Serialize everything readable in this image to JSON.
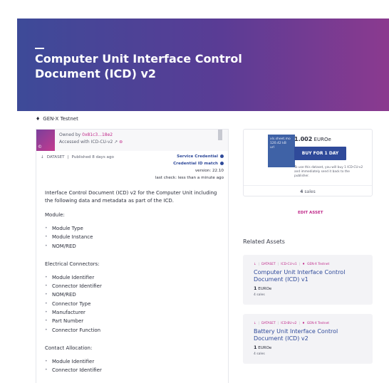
{
  "asset": {
    "title": "Computer Unit Interface Control Document (ICD) v2",
    "network": "GEN-X Testnet",
    "owned_by_label": "Owned by",
    "owner": "0x81c3...18e2",
    "accessed_with_label": "Accessed with",
    "accessed_with": "ICD-CU-v2",
    "type": "DATASET",
    "published": "Published 8 days ago",
    "service_credential": "Service Credential",
    "credential_id_match": "Credential ID match",
    "version": "version: 22.10",
    "last_check": "last check: less than a minute ago",
    "description_intro": "Interface Control Document (ICD) v2 for the Computer Unit including the following data and metadata as part of the ICD.",
    "sections": [
      {
        "title": "Module:",
        "items": [
          "Module Type",
          "Module Instance",
          "NOM/RED"
        ]
      },
      {
        "title": "Electrical Connectors:",
        "items": [
          "Module Identifier",
          "Connector Identifier",
          "NOM/RED",
          "Connector Type",
          "Manufacturer",
          "Part Number",
          "Connector Function"
        ]
      },
      {
        "title": "Contact Allocation:",
        "items": [
          "Module Identifier",
          "Connector Identifier"
        ]
      }
    ]
  },
  "buy": {
    "thumb_lines": [
      "xls.sheet.mo",
      "120.42 kB",
      "url"
    ],
    "price": "1.002",
    "currency": "EUROe",
    "button": "BUY FOR 1 DAY",
    "note": "To use this dataset, you will buy 1 ICD-CU-v2 and immediately send it back to the publisher.",
    "sales_count": "4",
    "sales_label": "sales"
  },
  "edit_label": "EDIT ASSET",
  "related": {
    "title": "Related Assets",
    "items": [
      {
        "type": "DATASET",
        "symbol": "ICD-CU-v1",
        "network": "GEN-X Testnet",
        "title": "Computer Unit Interface Control Document (ICD) v1",
        "price": "1",
        "currency": "EUROe",
        "sales": "4 sales"
      },
      {
        "type": "DATASET",
        "symbol": "ICD-BU-v2",
        "network": "GEN-X Testnet",
        "title": "Battery Unit Interface Control Document (ICD) v2",
        "price": "1",
        "currency": "EUROe",
        "sales": "4 sales"
      }
    ]
  }
}
